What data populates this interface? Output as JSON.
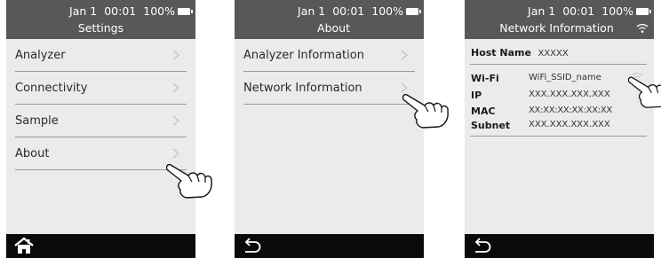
{
  "status": {
    "date": "Jan 1",
    "time": "00:01",
    "battery": "100%"
  },
  "screen1": {
    "title": "Settings",
    "items": [
      {
        "label": "Analyzer"
      },
      {
        "label": "Connectivity"
      },
      {
        "label": "Sample"
      },
      {
        "label": "About"
      }
    ]
  },
  "screen2": {
    "title": "About",
    "items": [
      {
        "label": "Analyzer Information"
      },
      {
        "label": "Network Information"
      }
    ]
  },
  "screen3": {
    "title": "Network Information",
    "host_name_key": "Host Name",
    "host_name_val": "XXXXX",
    "wifi_key": "Wi-Fi",
    "wifi_val": "WiFi_SSID_name",
    "ip_key": "IP",
    "ip_val": "XXX.XXX.XXX.XXX",
    "mac_key": "MAC",
    "mac_val": "XX:XX:XX:XX:XX:XX",
    "subnet_key": "Subnet",
    "subnet_val": "XXX.XXX.XXX.XXX"
  },
  "icons": {
    "home": "home-icon",
    "back": "back-arrow-icon",
    "chevron": "chevron-right-icon",
    "wifi": "wifi-icon",
    "battery": "battery-icon",
    "hand": "pointing-hand-icon"
  },
  "colors": {
    "statusbar": "#585858",
    "bottombar": "#0a0a0a",
    "background": "#ebebeb"
  }
}
